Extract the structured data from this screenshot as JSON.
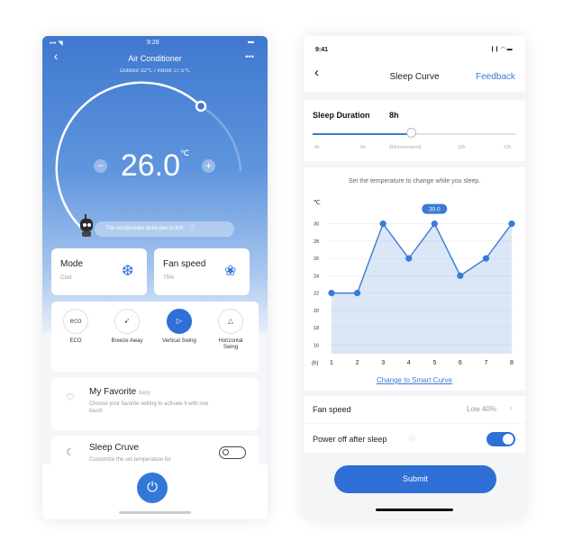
{
  "left_phone": {
    "status": {
      "signal": "••• ◥",
      "time": "9:28",
      "battery": "▬"
    },
    "header": {
      "back": "‹",
      "title": "Air Conditioner",
      "subtitle": "Outdoor 32℃ / indoor 27.5℃",
      "more": "•••"
    },
    "temperature": {
      "value": "26.0",
      "unit": "℃",
      "minus": "−",
      "plus": "+"
    },
    "alert": {
      "text": "The condensate drain pan is full!",
      "icon": "ⓘ"
    },
    "mode_card": {
      "label": "Mode",
      "value": "Cool",
      "icon": "snowflake-icon",
      "glyph": "❆"
    },
    "fan_card": {
      "label": "Fan speed",
      "value": "75%",
      "icon": "fan-icon",
      "glyph": "❀"
    },
    "functions": [
      {
        "name": "ECO",
        "glyph": "eco",
        "active": false
      },
      {
        "name": "Breeze Away",
        "glyph": "➹",
        "active": false
      },
      {
        "name": "Vertical Swing",
        "glyph": "▷",
        "active": true
      },
      {
        "name": "Horizontal Swing",
        "glyph": "△",
        "active": false
      }
    ],
    "favorite": {
      "title": "My Favorite",
      "tag": "baby",
      "desc": "Choose your favorite setting to activate it with one touch",
      "icon": "♡"
    },
    "sleep": {
      "title": "Sleep Cruve",
      "desc": "Customize the set temperature for",
      "icon": "☾"
    },
    "power_glyph": "⏻"
  },
  "right_phone": {
    "status": {
      "time": "9:41",
      "icons": "❙❙ ◠ ▬"
    },
    "header": {
      "back": "‹",
      "title": "Sleep Curve",
      "feedback": "Feedback"
    },
    "duration": {
      "label": "Sleep Duration",
      "value": "8h",
      "ticks": [
        "4h",
        "6h",
        "8h(recommend)",
        "10h",
        "12h"
      ]
    },
    "hint": "Set the temperature to change while you sleep.",
    "chart_data": {
      "type": "line",
      "yunit": "℃",
      "xunit": "(h)",
      "x": [
        1,
        2,
        3,
        4,
        5,
        6,
        7,
        8
      ],
      "y": [
        22,
        22,
        30,
        26,
        30,
        24,
        26,
        30
      ],
      "yticks": [
        30,
        28,
        26,
        24,
        22,
        20,
        18,
        16
      ],
      "ylim": [
        15,
        31
      ],
      "highlight": {
        "x": 5,
        "label": "30.0"
      },
      "color": "#3a7bd5"
    },
    "smart_link": "Change to Smart Curve",
    "fan": {
      "label": "Fan speed",
      "value": "Low 40%",
      "chevron": "›"
    },
    "power_off": {
      "label": "Power off after sleep",
      "info": "ⓘ"
    },
    "submit": "Submit"
  }
}
